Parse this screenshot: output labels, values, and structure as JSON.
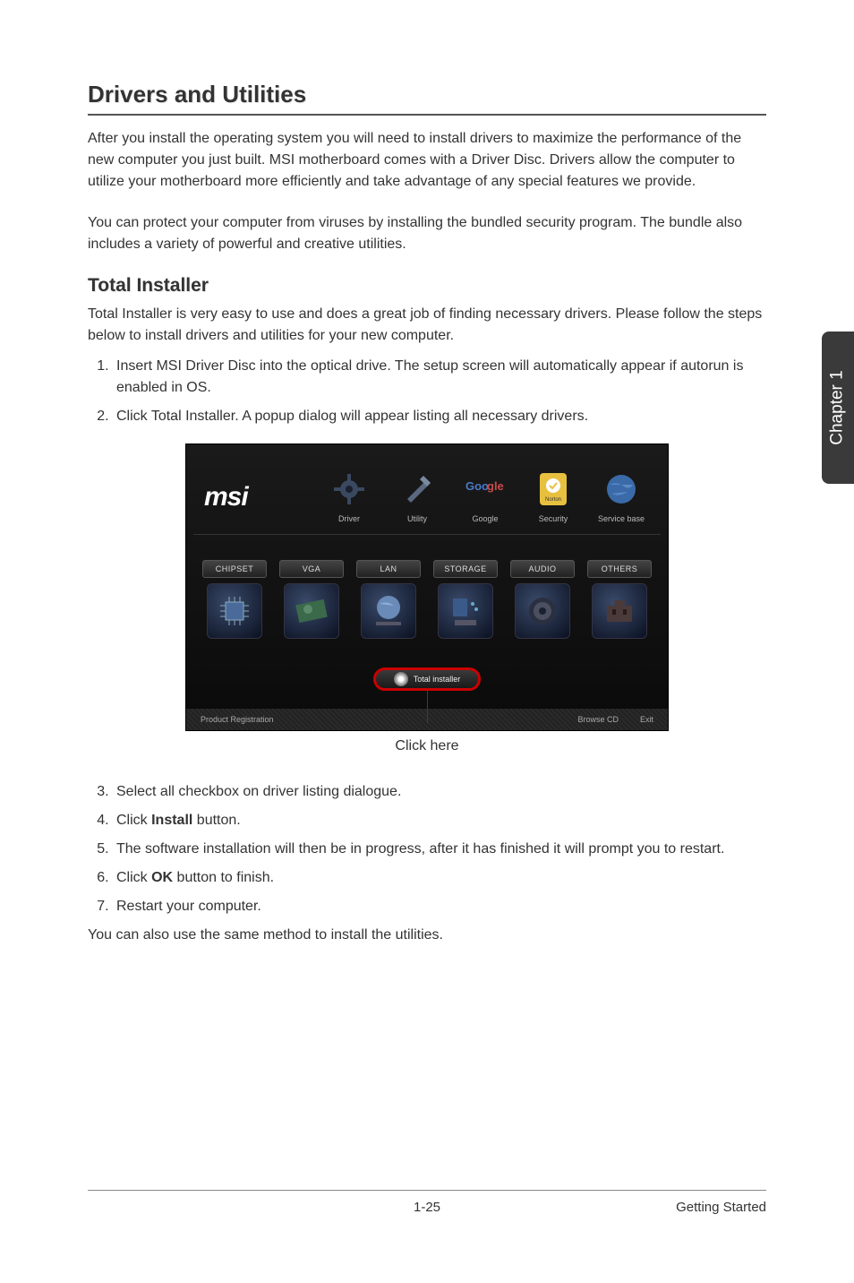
{
  "heading": "Drivers and Utilities",
  "intro_p1": "After you install the operating system you will need to install drivers to maximize the performance of the new computer you just built. MSI motherboard comes with a Driver Disc. Drivers allow the computer to utilize your motherboard more efficiently and take advantage of any special features we provide.",
  "intro_p2": "You can protect your computer from viruses by installing the bundled security program. The bundle also includes a variety of powerful and creative utilities.",
  "subheading": "Total Installer",
  "sub_intro": "Total Installer is very easy to use and does a great job of finding necessary drivers. Please follow the steps below to install drivers and utilities for your new computer.",
  "steps_top": [
    "Insert MSI Driver Disc into the optical drive. The setup screen will automatically appear if autorun is enabled in OS.",
    "Click Total Installer. A popup dialog will appear listing all necessary drivers."
  ],
  "screenshot": {
    "logo": "msi",
    "top_icons": [
      {
        "label": "Driver"
      },
      {
        "label": "Utility"
      },
      {
        "label": "Google"
      },
      {
        "label": "Security"
      },
      {
        "label": "Service base"
      }
    ],
    "categories": [
      "CHIPSET",
      "VGA",
      "LAN",
      "STORAGE",
      "AUDIO",
      "OTHERS"
    ],
    "total_installer_label": "Total installer",
    "bottom_left": "Product Registration",
    "bottom_mid": "Browse CD",
    "bottom_right": "Exit"
  },
  "click_here_label": "Click here",
  "steps_bottom": [
    {
      "pre": "Select all checkbox on driver listing dialogue.",
      "bold": "",
      "post": ""
    },
    {
      "pre": "Click ",
      "bold": "Install",
      "post": " button."
    },
    {
      "pre": "The software installation will then be in progress, after it has finished it will prompt you to restart.",
      "bold": "",
      "post": ""
    },
    {
      "pre": "Click ",
      "bold": "OK",
      "post": " button to finish."
    },
    {
      "pre": "Restart your computer.",
      "bold": "",
      "post": ""
    }
  ],
  "closing": "You can also use the same method to install the utilities.",
  "sidebar": "Chapter 1",
  "footer_page": "1-25",
  "footer_section": "Getting Started"
}
